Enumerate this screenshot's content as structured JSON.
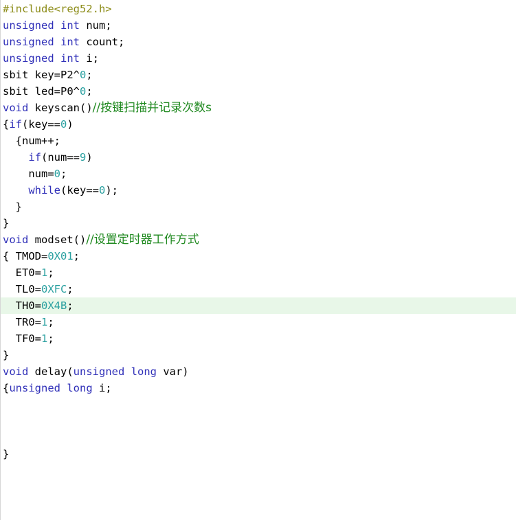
{
  "editor": {
    "lines": [
      {
        "tokens": [
          {
            "t": "pp",
            "v": "#include<reg52.h>"
          }
        ]
      },
      {
        "tokens": [
          {
            "t": "kw",
            "v": "unsigned"
          },
          {
            "t": "id",
            "v": " "
          },
          {
            "t": "kw",
            "v": "int"
          },
          {
            "t": "id",
            "v": " num;"
          }
        ]
      },
      {
        "tokens": [
          {
            "t": "kw",
            "v": "unsigned"
          },
          {
            "t": "id",
            "v": " "
          },
          {
            "t": "kw",
            "v": "int"
          },
          {
            "t": "id",
            "v": " count;"
          }
        ]
      },
      {
        "tokens": [
          {
            "t": "kw",
            "v": "unsigned"
          },
          {
            "t": "id",
            "v": " "
          },
          {
            "t": "kw",
            "v": "int"
          },
          {
            "t": "id",
            "v": " i;"
          }
        ]
      },
      {
        "tokens": [
          {
            "t": "id",
            "v": "sbit key=P2^"
          },
          {
            "t": "num",
            "v": "0"
          },
          {
            "t": "id",
            "v": ";"
          }
        ]
      },
      {
        "tokens": [
          {
            "t": "id",
            "v": "sbit led=P0^"
          },
          {
            "t": "num",
            "v": "0"
          },
          {
            "t": "id",
            "v": ";"
          }
        ]
      },
      {
        "tokens": [
          {
            "t": "kw",
            "v": "void"
          },
          {
            "t": "id",
            "v": " keyscan()"
          },
          {
            "t": "cm",
            "v": "//按键扫描并记录次数s"
          }
        ]
      },
      {
        "tokens": [
          {
            "t": "id",
            "v": "{"
          },
          {
            "t": "kw",
            "v": "if"
          },
          {
            "t": "id",
            "v": "(key=="
          },
          {
            "t": "num",
            "v": "0"
          },
          {
            "t": "id",
            "v": ")"
          }
        ]
      },
      {
        "tokens": [
          {
            "t": "id",
            "v": "  {num++;"
          }
        ]
      },
      {
        "tokens": [
          {
            "t": "id",
            "v": "    "
          },
          {
            "t": "kw",
            "v": "if"
          },
          {
            "t": "id",
            "v": "(num=="
          },
          {
            "t": "num",
            "v": "9"
          },
          {
            "t": "id",
            "v": ")"
          }
        ]
      },
      {
        "tokens": [
          {
            "t": "id",
            "v": "    num="
          },
          {
            "t": "num",
            "v": "0"
          },
          {
            "t": "id",
            "v": ";"
          }
        ]
      },
      {
        "tokens": [
          {
            "t": "id",
            "v": "    "
          },
          {
            "t": "kw",
            "v": "while"
          },
          {
            "t": "id",
            "v": "(key=="
          },
          {
            "t": "num",
            "v": "0"
          },
          {
            "t": "id",
            "v": ");"
          }
        ]
      },
      {
        "tokens": [
          {
            "t": "id",
            "v": "  }"
          }
        ]
      },
      {
        "tokens": [
          {
            "t": "id",
            "v": "}"
          }
        ]
      },
      {
        "tokens": [
          {
            "t": "kw",
            "v": "void"
          },
          {
            "t": "id",
            "v": " modset()"
          },
          {
            "t": "cm",
            "v": "//设置定时器工作方式"
          }
        ]
      },
      {
        "tokens": [
          {
            "t": "id",
            "v": "{ TMOD="
          },
          {
            "t": "num",
            "v": "0X01"
          },
          {
            "t": "id",
            "v": ";"
          }
        ]
      },
      {
        "tokens": [
          {
            "t": "id",
            "v": "  ET0="
          },
          {
            "t": "num",
            "v": "1"
          },
          {
            "t": "id",
            "v": ";"
          }
        ]
      },
      {
        "tokens": [
          {
            "t": "id",
            "v": "  TL0="
          },
          {
            "t": "num",
            "v": "0XFC"
          },
          {
            "t": "id",
            "v": ";"
          }
        ]
      },
      {
        "highlight": true,
        "tokens": [
          {
            "t": "id",
            "v": "  TH0="
          },
          {
            "t": "num",
            "v": "0X4B"
          },
          {
            "t": "id",
            "v": ";"
          }
        ]
      },
      {
        "tokens": [
          {
            "t": "id",
            "v": "  TR0="
          },
          {
            "t": "num",
            "v": "1"
          },
          {
            "t": "id",
            "v": ";"
          }
        ]
      },
      {
        "tokens": [
          {
            "t": "id",
            "v": "  TF0="
          },
          {
            "t": "num",
            "v": "1"
          },
          {
            "t": "id",
            "v": ";"
          }
        ]
      },
      {
        "tokens": [
          {
            "t": "id",
            "v": "}"
          }
        ]
      },
      {
        "tokens": [
          {
            "t": "kw",
            "v": "void"
          },
          {
            "t": "id",
            "v": " delay("
          },
          {
            "t": "kw",
            "v": "unsigned"
          },
          {
            "t": "id",
            "v": " "
          },
          {
            "t": "kw",
            "v": "long"
          },
          {
            "t": "id",
            "v": " var)"
          }
        ]
      },
      {
        "tokens": [
          {
            "t": "id",
            "v": "{"
          },
          {
            "t": "kw",
            "v": "unsigned"
          },
          {
            "t": "id",
            "v": " "
          },
          {
            "t": "kw",
            "v": "long"
          },
          {
            "t": "id",
            "v": " i;"
          }
        ]
      },
      {
        "tokens": []
      },
      {
        "tokens": []
      },
      {
        "tokens": []
      },
      {
        "tokens": [
          {
            "t": "id",
            "v": "}"
          }
        ]
      }
    ]
  },
  "colors": {
    "keyword": "#2f2fb8",
    "number": "#2aa0a0",
    "preprocessor": "#8c8c18",
    "comment": "#218a21",
    "current_line": "#e8f7e8"
  }
}
